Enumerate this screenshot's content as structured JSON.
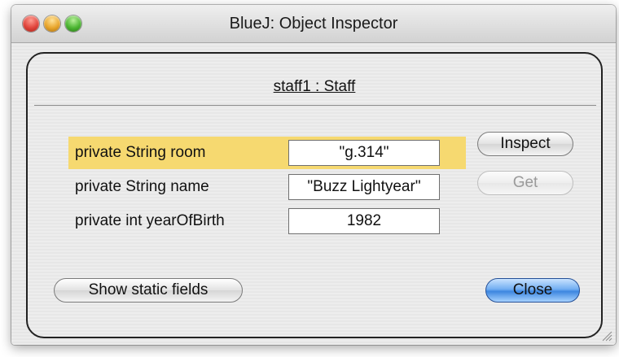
{
  "window": {
    "title": "BlueJ:  Object Inspector"
  },
  "object": {
    "header": "staff1 : Staff"
  },
  "fields": [
    {
      "label": "private String room",
      "value": "\"g.314\"",
      "selected": true
    },
    {
      "label": "private String name",
      "value": "\"Buzz Lightyear\"",
      "selected": false
    },
    {
      "label": "private int yearOfBirth",
      "value": "1982",
      "selected": false
    }
  ],
  "buttons": {
    "inspect": "Inspect",
    "get": "Get",
    "show_static": "Show static fields",
    "close": "Close"
  },
  "colors": {
    "selection_highlight": "#f6d970",
    "close_button": "#3d86e0"
  }
}
